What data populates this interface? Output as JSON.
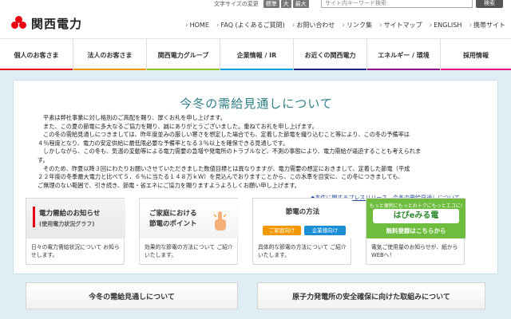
{
  "header": {
    "logo_text": "関西電力",
    "font_size_label": "文字サイズの変更",
    "font_sizes": [
      "標準",
      "大",
      "最大"
    ],
    "search_placeholder": "サイト内キーワード検索",
    "search_button": "検索",
    "util_links": [
      "HOME",
      "FAQ (よくあるご質問)",
      "お問い合わせ",
      "リンク集",
      "サイトマップ",
      "ENGLISH",
      "携帯サイト"
    ]
  },
  "gnav": [
    "個人のお客さま",
    "法人のお客さま",
    "関西電力グループ",
    "企業情報 / IR",
    "お近くの関西電力",
    "エネルギー / 環境",
    "採用情報"
  ],
  "notice": {
    "title": "今冬の需給見通しについて",
    "paragraphs": [
      "平素は弊社事業に対し格別のご高配を賜り、厚くお礼を申し上げます。",
      "また、この夏の節電に多大なるご協力を賜り、誠にありがとうございました。重ねてお礼を申し上げます。",
      "この冬の需給見通しにつきましては、昨年度並みの厳しい寒さを想定した場合でも、定着した節電を織り込むこと等により、この冬の予備率は",
      "４％程度となり、電力の安定供給に最低限必要な予備率となる３％以上を確保できる見通しです。",
      "しかしながら、この冬も、気温の変動等による電力需要の急増や発電所のトラブルなど、不測の事態により、電力需給が逼迫することも考えられま",
      "す。",
      "そのため、昨夏以降３回にわたりお願いさせていただきました数値目標とは異なりますが、電力需要の想定におきまして、定着した節電（平成",
      "２２年度の冬季最大電力と比べて５．６％に当たる１４８万ｋＷ）を見込んでおりますことから、この水準を目安に、この冬につきましても、",
      "ご無理のない範囲で、引き続き、節電・省エネにご協力を賜りますようよろしくお願い申し上げます。"
    ],
    "press_link": "◆本件に関するプレスリリース　今冬の需給見通しについて"
  },
  "cards": {
    "power": {
      "title": "電力需給のお知らせ",
      "subtitle": "(使用電力状況グラフ)",
      "desc": "日々の電力需給状況について お知らせします。"
    },
    "home": {
      "title_line1": "ご家庭における",
      "title_line2": "節電のポイント",
      "desc": "効果的な節電の方法について ご紹介いたします。"
    },
    "method": {
      "title": "節電の方法",
      "btn_home": "ご家庭向け",
      "btn_business": "企業様向け",
      "desc": "具体的な節電の方法について ご紹介いたします。"
    },
    "hapie": {
      "tagline": "もっと便利にもっとおトクにもっとエコに!",
      "logo": "はぴeみる電",
      "cta": "無料登録はこちらから",
      "desc": "電気ご使用量のお知らせが、紙からWEBへ！"
    }
  },
  "bottom_tabs": [
    "今冬の需給見通しについて",
    "原子力発電所の安全確保に向けた取組みについて"
  ],
  "colors": {
    "brand_red": "#e60012",
    "title_teal": "#2f7f88",
    "main_bg": "#dfeef5",
    "hapie_green": "#6fbd3f"
  }
}
